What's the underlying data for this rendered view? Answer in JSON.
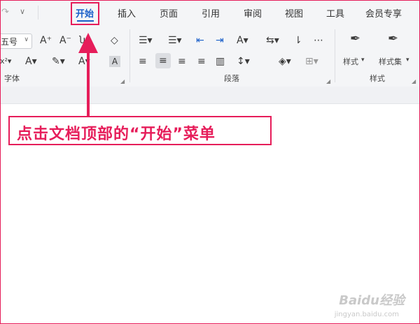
{
  "tabs": [
    "开始",
    "插入",
    "页面",
    "引用",
    "审阅",
    "视图",
    "工具",
    "会员专享"
  ],
  "font_size_value": "五号",
  "group_font_label": "字体",
  "group_para_label": "段落",
  "group_style_label": "样式",
  "style_button_label": "样式",
  "style_set_button_label": "样式集",
  "callout_text": "点击文档顶部的“开始”菜单",
  "watermark_text": "Baidu经验",
  "watermark_url": "jingyan.baidu.com",
  "accent_color": "#e61d5a",
  "active_tab_color": "#1a5fc9"
}
